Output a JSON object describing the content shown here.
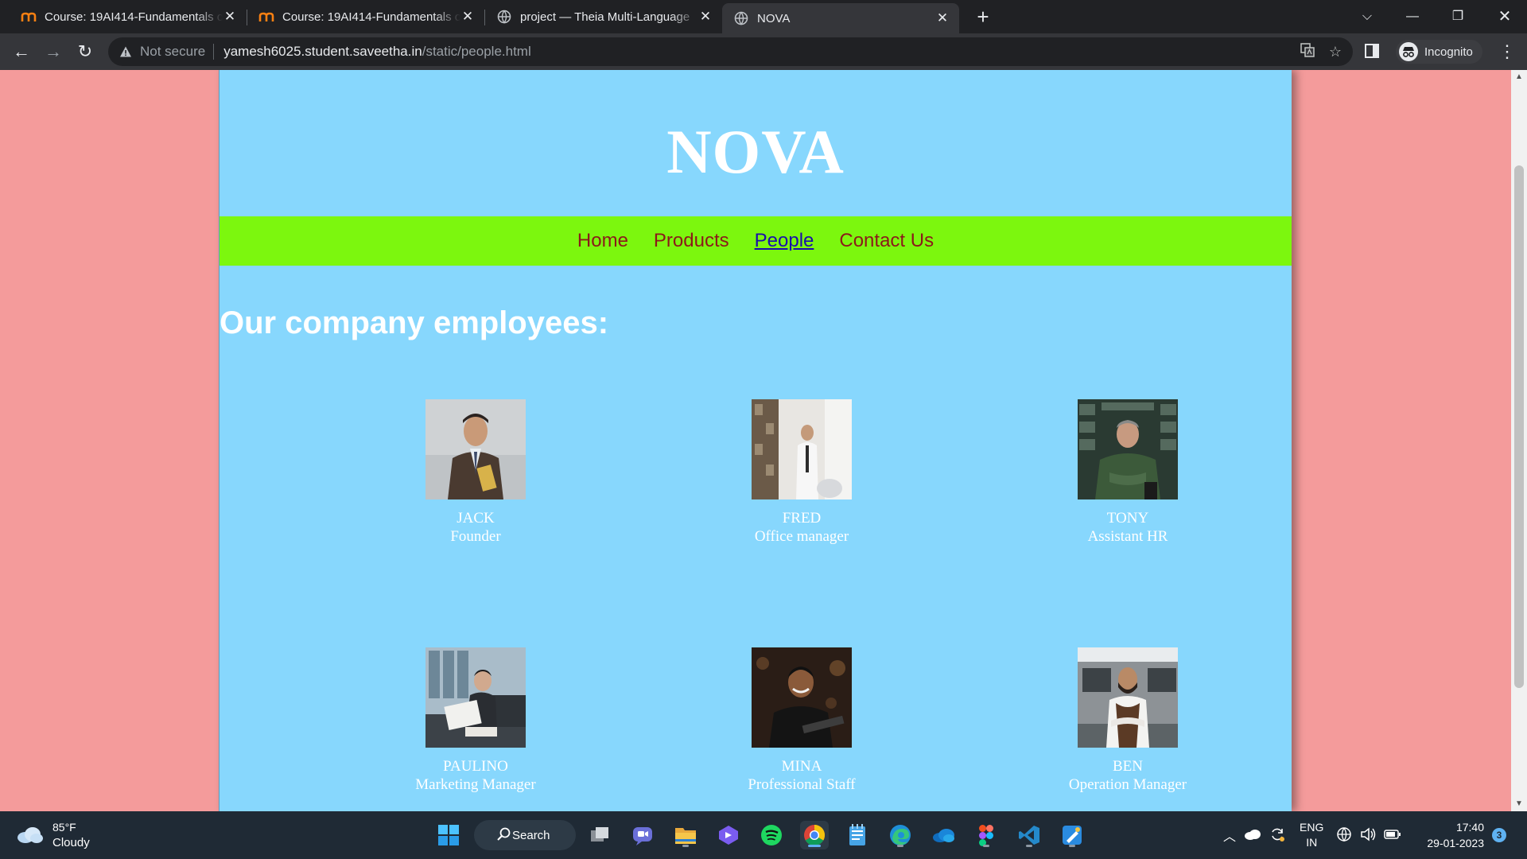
{
  "browser": {
    "tabs": [
      {
        "title": "Course: 19AI414-Fundamentals of",
        "icon": "moodle-icon",
        "active": false
      },
      {
        "title": "Course: 19AI414-Fundamentals of",
        "icon": "moodle-icon",
        "active": false
      },
      {
        "title": "project — Theia Multi-Language",
        "icon": "globe-icon",
        "active": false
      },
      {
        "title": "NOVA",
        "icon": "globe-icon",
        "active": true
      }
    ],
    "security_label": "Not secure",
    "url_host": "yamesh6025.student.saveetha.in",
    "url_path": "/static/people.html",
    "profile_label": "Incognito"
  },
  "site": {
    "brand": "NOVA",
    "nav": [
      {
        "label": "Home",
        "current": false
      },
      {
        "label": "Products",
        "current": false
      },
      {
        "label": "People",
        "current": true
      },
      {
        "label": "Contact Us",
        "current": false
      }
    ],
    "section_title": "Our company employees:",
    "employees": [
      {
        "name": "JACK",
        "role": "Founder"
      },
      {
        "name": "FRED",
        "role": "Office manager"
      },
      {
        "name": "TONY",
        "role": "Assistant HR"
      },
      {
        "name": "PAULINO",
        "role": "Marketing Manager"
      },
      {
        "name": "MINA",
        "role": "Professional Staff"
      },
      {
        "name": "BEN",
        "role": "Operation Manager"
      }
    ]
  },
  "taskbar": {
    "weather_temp": "85°F",
    "weather_desc": "Cloudy",
    "search_label": "Search",
    "lang_top": "ENG",
    "lang_bottom": "IN",
    "time": "17:40",
    "date": "29-01-2023",
    "notification_count": "3"
  }
}
